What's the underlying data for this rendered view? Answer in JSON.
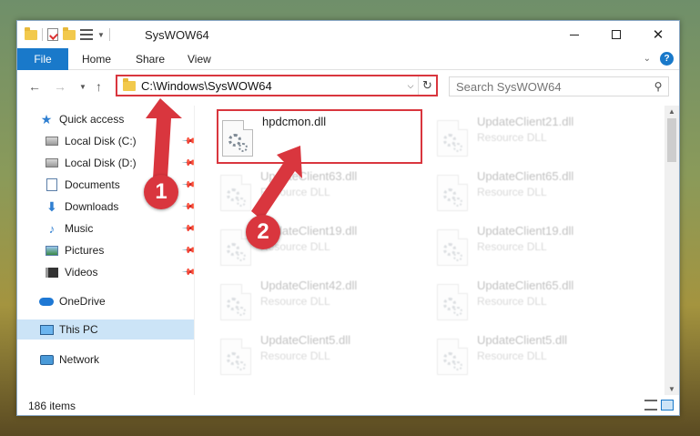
{
  "window": {
    "title": "SysWOW64",
    "controls": {
      "minimize": "—",
      "maximize": "☐",
      "close": "✕"
    }
  },
  "ribbon": {
    "tabs": [
      {
        "label": "File"
      },
      {
        "label": "Home"
      },
      {
        "label": "Share"
      },
      {
        "label": "View"
      }
    ],
    "help": "?"
  },
  "navigation": {
    "address": "C:\\Windows\\SysWOW64",
    "search_placeholder": "Search SysWOW64"
  },
  "sidebar": {
    "items": [
      {
        "label": "Quick access",
        "icon": "star-icon"
      },
      {
        "label": "Local Disk (C:)",
        "icon": "disk-icon",
        "pinned": true
      },
      {
        "label": "Local Disk (D:)",
        "icon": "disk-icon",
        "pinned": true
      },
      {
        "label": "Documents",
        "icon": "documents-icon",
        "pinned": true
      },
      {
        "label": "Downloads",
        "icon": "download-icon",
        "pinned": true
      },
      {
        "label": "Music",
        "icon": "music-icon",
        "pinned": true
      },
      {
        "label": "Pictures",
        "icon": "pictures-icon",
        "pinned": true
      },
      {
        "label": "Videos",
        "icon": "videos-icon",
        "pinned": true
      },
      {
        "label": "OneDrive",
        "icon": "onedrive-icon"
      },
      {
        "label": "This PC",
        "icon": "this-pc-icon",
        "selected": true
      },
      {
        "label": "Network",
        "icon": "network-icon"
      }
    ]
  },
  "files": [
    {
      "name": "hpdcmon.dll",
      "type": "",
      "highlighted": true
    },
    {
      "name": "UpdateClient21.dll",
      "type": "Resource DLL"
    },
    {
      "name": "UpdateClient63.dll",
      "type": "Resource DLL"
    },
    {
      "name": "UpdateClient65.dll",
      "type": "Resource DLL"
    },
    {
      "name": "UpdateClient19.dll",
      "type": "Resource DLL"
    },
    {
      "name": "UpdateClient19.dll",
      "type": "Resource DLL"
    },
    {
      "name": "UpdateClient42.dll",
      "type": "Resource DLL"
    },
    {
      "name": "UpdateClient65.dll",
      "type": "Resource DLL"
    },
    {
      "name": "UpdateClient5.dll",
      "type": "Resource DLL"
    },
    {
      "name": "UpdateClient5.dll",
      "type": "Resource DLL"
    }
  ],
  "status": {
    "item_count": "186 items"
  },
  "annotations": {
    "step1": "1",
    "step2": "2",
    "color": "#d9363e"
  },
  "colors": {
    "accent": "#1979ca",
    "selection": "#cce4f7",
    "highlight": "#d9363e"
  }
}
